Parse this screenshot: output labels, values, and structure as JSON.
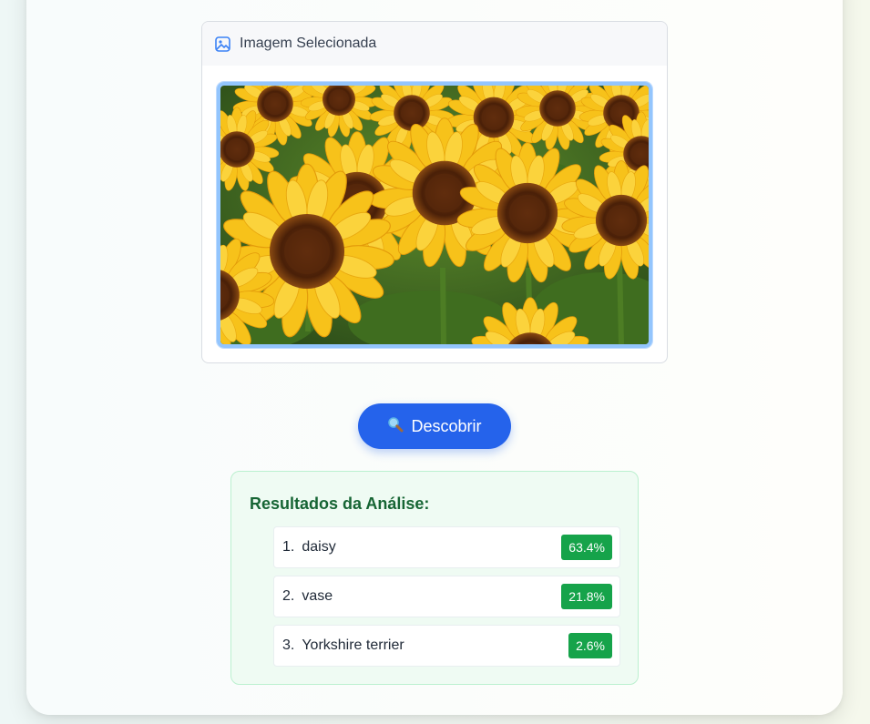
{
  "image_panel": {
    "title": "Imagem Selecionada",
    "icon": "image-icon"
  },
  "actions": {
    "discover_label": "Descobrir",
    "discover_icon": "magnifier-icon"
  },
  "results": {
    "title": "Resultados da Análise:",
    "items": [
      {
        "rank": "1.",
        "label": "daisy",
        "score": "63.4%"
      },
      {
        "rank": "2.",
        "label": "vase",
        "score": "21.8%"
      },
      {
        "rank": "3.",
        "label": "Yorkshire terrier",
        "score": "2.6%"
      }
    ]
  },
  "colors": {
    "primary": "#2563eb",
    "success": "#16a34a",
    "results_title": "#166534",
    "results_bg": "#effbf3",
    "selected_border": "#93c5fd"
  }
}
